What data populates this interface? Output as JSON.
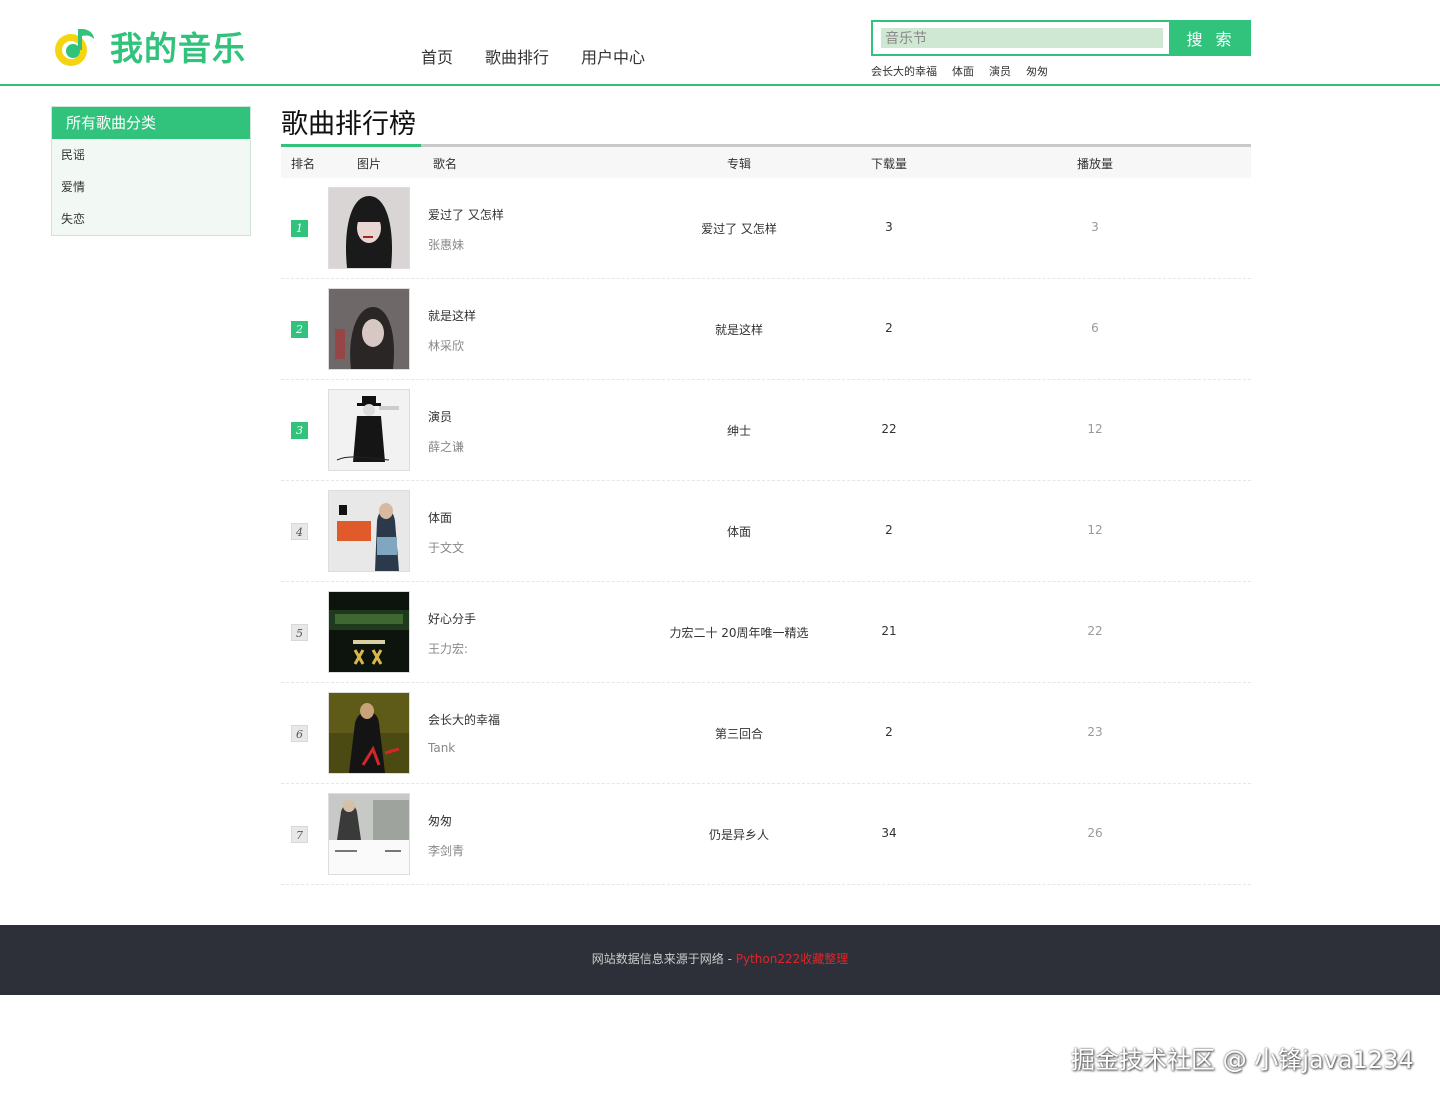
{
  "brand": {
    "name": "我的音乐",
    "accent": "#31c27c"
  },
  "nav": [
    {
      "label": "首页"
    },
    {
      "label": "歌曲排行"
    },
    {
      "label": "用户中心"
    }
  ],
  "search": {
    "value": "音乐节",
    "button": "搜 索"
  },
  "hot_searches": [
    "会长大的幸福",
    "体面",
    "演员",
    "匆匆"
  ],
  "sidebar": {
    "title": "所有歌曲分类",
    "items": [
      {
        "label": "民谣"
      },
      {
        "label": "爱情"
      },
      {
        "label": "失恋"
      }
    ]
  },
  "main": {
    "title": "歌曲排行榜",
    "columns": {
      "rank": "排名",
      "image": "图片",
      "song": "歌名",
      "album": "专辑",
      "downloads": "下载量",
      "plays": "播放量"
    },
    "rows": [
      {
        "rank": "1",
        "song": "爱过了 又怎样",
        "singer": "张惠妹",
        "album": "爱过了 又怎样",
        "downloads": "3",
        "plays": "3"
      },
      {
        "rank": "2",
        "song": "就是这样",
        "singer": "林采欣",
        "album": "就是这样",
        "downloads": "2",
        "plays": "6"
      },
      {
        "rank": "3",
        "song": "演员",
        "singer": "薛之谦",
        "album": "绅士",
        "downloads": "22",
        "plays": "12"
      },
      {
        "rank": "4",
        "song": "体面",
        "singer": "于文文",
        "album": "体面",
        "downloads": "2",
        "plays": "12"
      },
      {
        "rank": "5",
        "song": "好心分手",
        "singer": "王力宏:",
        "album": "力宏二十 20周年唯一精选",
        "downloads": "21",
        "plays": "22"
      },
      {
        "rank": "6",
        "song": "会长大的幸福",
        "singer": "Tank",
        "album": "第三回合",
        "downloads": "2",
        "plays": "23"
      },
      {
        "rank": "7",
        "song": "匆匆",
        "singer": "李剑青",
        "album": "仍是异乡人",
        "downloads": "34",
        "plays": "26"
      }
    ]
  },
  "footer": {
    "text": "网站数据信息来源于网络 - ",
    "link": "Python222收藏整理"
  },
  "watermark": "掘金技术社区 @ 小锋java1234"
}
